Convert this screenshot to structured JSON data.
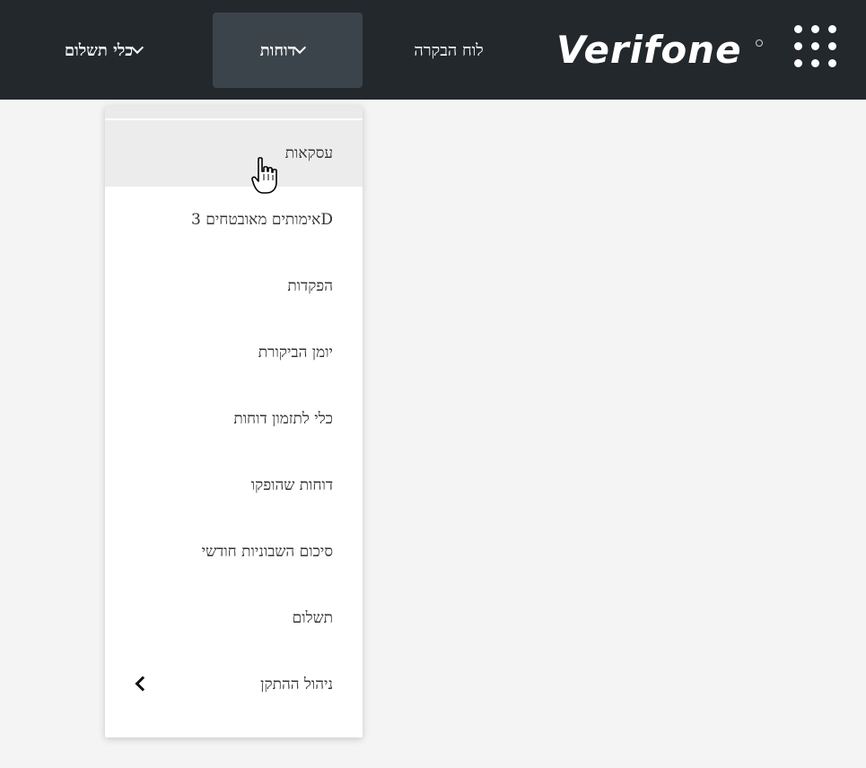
{
  "header": {
    "logo_text": "Verifone",
    "nav": {
      "dashboard": "לוח הבקרה",
      "reports": "דוחות",
      "payment_tools": "כלי תשלום"
    },
    "colors": {
      "bar": "#23282d",
      "active": "#3c444b"
    },
    "apps_icon": "grid-dots-icon"
  },
  "reports_menu": {
    "items": [
      "עסקאות",
      "אימותים מאובטחים 3D",
      "הפקדות",
      "יומן הביקורת",
      "כלי לתזמון דוחות",
      "דוחות שהופקו",
      "סיכום השבוניות חודשי",
      "תשלום",
      "ניהול ההתקן"
    ],
    "highlighted": "עסקאות",
    "submenu_icon": "chevron-left-icon"
  },
  "cursor": "hand-pointer-icon"
}
